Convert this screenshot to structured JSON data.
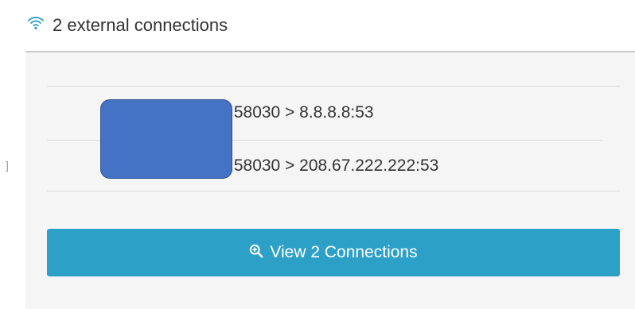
{
  "header": {
    "icon": "wifi-icon",
    "title": "2 external connections"
  },
  "connections": [
    {
      "label": ":58030 > 8.8.8.8:53"
    },
    {
      "label": ":58030 > 208.67.222.222:53"
    }
  ],
  "left_mark": "]",
  "button": {
    "icon": "zoom-in-icon",
    "label": "View 2 Connections"
  },
  "colors": {
    "accent": "#2da0c8",
    "redaction": "#4472c4",
    "panel_bg": "#f5f5f5"
  }
}
